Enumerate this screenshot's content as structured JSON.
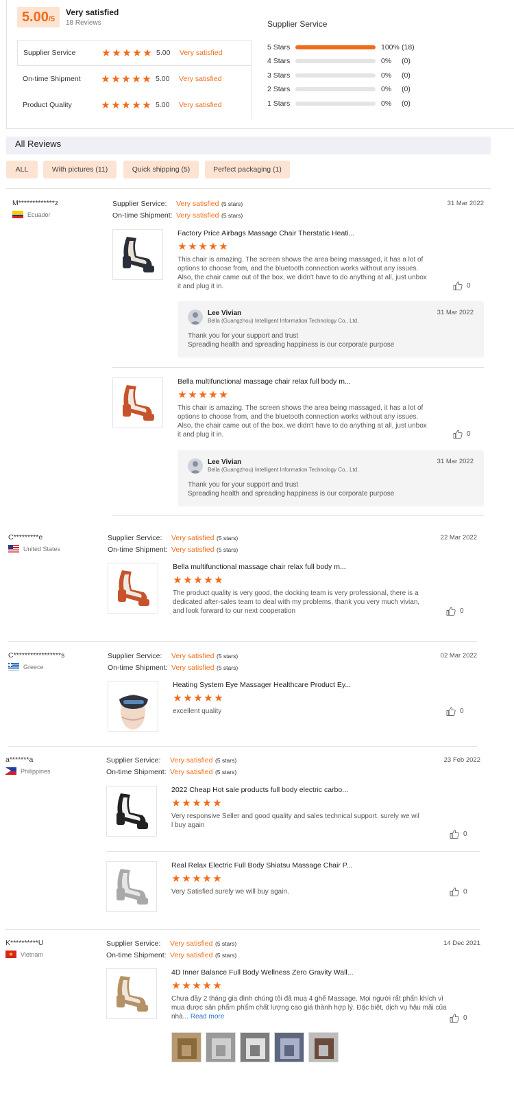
{
  "summary": {
    "score": "5.00",
    "score_suffix": "/5",
    "label": "Very satisfied",
    "review_count": "18 Reviews",
    "metrics": [
      {
        "label": "Supplier Service",
        "value": "5.00",
        "text": "Very satisfied",
        "rating": 5
      },
      {
        "label": "On-time Shipment",
        "value": "5.00",
        "text": "Very satisfied",
        "rating": 5
      },
      {
        "label": "Product Quality",
        "value": "5.00",
        "text": "Very satisfied",
        "rating": 5
      }
    ],
    "distribution_title": "Supplier Service",
    "distribution": [
      {
        "label": "5 Stars",
        "percent": "100%",
        "count": "(18)",
        "fraction": 1.0
      },
      {
        "label": "4 Stars",
        "percent": "0%",
        "count": "(0)",
        "fraction": 0
      },
      {
        "label": "3 Stars",
        "percent": "0%",
        "count": "(0)",
        "fraction": 0
      },
      {
        "label": "2 Stars",
        "percent": "0%",
        "count": "(0)",
        "fraction": 0
      },
      {
        "label": "1 Stars",
        "percent": "0%",
        "count": "(0)",
        "fraction": 0
      }
    ]
  },
  "reviews_header": "All Reviews",
  "filters": [
    "ALL",
    "With pictures (11)",
    "Quick shipping (5)",
    "Perfect packaging (1)"
  ],
  "labels": {
    "supplier_service": "Supplier Service:",
    "ontime_shipment": "On-time Shipment:",
    "very_satisfied": "Very satisfied",
    "five_stars": "(5 stars)",
    "read_more": "Read more"
  },
  "reviews": [
    {
      "name": "M*************z",
      "country": "Ecuador",
      "date": "31 Mar 2022",
      "items": [
        {
          "title": "Factory Price Airbags Massage Chair Therstatic Heati...",
          "text": "This chair is amazing. The screen shows the area being massaged, it has a lot of options to choose from, and the bluetooth connection works without any issues. Also, the chair came out of the box, we didn't have to do anything at all, just unbox it and plug it in.",
          "likes": "0",
          "reply": {
            "name": "Lee Vivian",
            "company": "Bella (Guangzhou) Intelligent Information Technology Co., Ltd.",
            "date": "31 Mar 2022",
            "line1": "Thank you for your support and trust",
            "line2": "Spreading health and spreading happiness is our corporate purpose"
          }
        },
        {
          "title": "Bella multifunctional massage chair relax full body m...",
          "text": "This chair is amazing. The screen shows the area being massaged, it has a lot of options to choose from, and the bluetooth connection works without any issues. Also, the chair came out of the box, we didn't have to do anything at all, just unbox it and plug it in.",
          "likes": "0",
          "reply": {
            "name": "Lee Vivian",
            "company": "Bella (Guangzhou) Intelligent Information Technology Co., Ltd.",
            "date": "31 Mar 2022",
            "line1": "Thank you for your support and trust",
            "line2": "Spreading health and spreading happiness is our corporate purpose"
          }
        }
      ]
    },
    {
      "name": "C*********e",
      "country": "United States",
      "date": "22 Mar 2022",
      "items": [
        {
          "title": "Bella multifunctional massage chair relax full body m...",
          "text": "The product quality is very good, the docking team is very professional, there is a dedicated after-sales team to deal with my problems, thank you very much vivian, and look forward to our next cooperation",
          "likes": "0"
        }
      ]
    },
    {
      "name": "C*****************s",
      "country": "Greece",
      "date": "02 Mar 2022",
      "items": [
        {
          "title": "Heating System Eye Massager Healthcare Product Ey...",
          "text": "excellent quality",
          "likes": "0"
        }
      ]
    },
    {
      "name": "a*******a",
      "country": "Philippines",
      "date": "23 Feb 2022",
      "items": [
        {
          "title": "2022 Cheap Hot sale products full body electric carbo...",
          "text": "Very responsive Seller and good quality and sales technical support. surely we wil l buy again",
          "likes": "0"
        },
        {
          "title": "Real Relax Electric Full Body Shiatsu Massage Chair P...",
          "text": "Very Satisfied surely we will buy again.",
          "likes": "0"
        }
      ]
    },
    {
      "name": "K**********U",
      "country": "Vietnam",
      "date": "14 Dec 2021",
      "items": [
        {
          "title": "4D Inner Balance Full Body Wellness Zero Gravity Wall...",
          "text": "Chưa đầy 2 tháng gia đình chúng tôi đã mua 4 ghế Massage. Mọi người rất phấn khích vì mua được sản phẩm phẩm chất lượng cao giá thành hợp lý. Đặc biệt, dịch vụ hậu mãi của nhà...",
          "likes": "0"
        }
      ]
    }
  ],
  "colors": {
    "accent": "#f06c1a",
    "accent_light": "#fde3d2",
    "track": "#e4e4e4"
  },
  "icons": [
    "star-icon",
    "thumbs-up-icon",
    "flag-icon",
    "avatar"
  ]
}
